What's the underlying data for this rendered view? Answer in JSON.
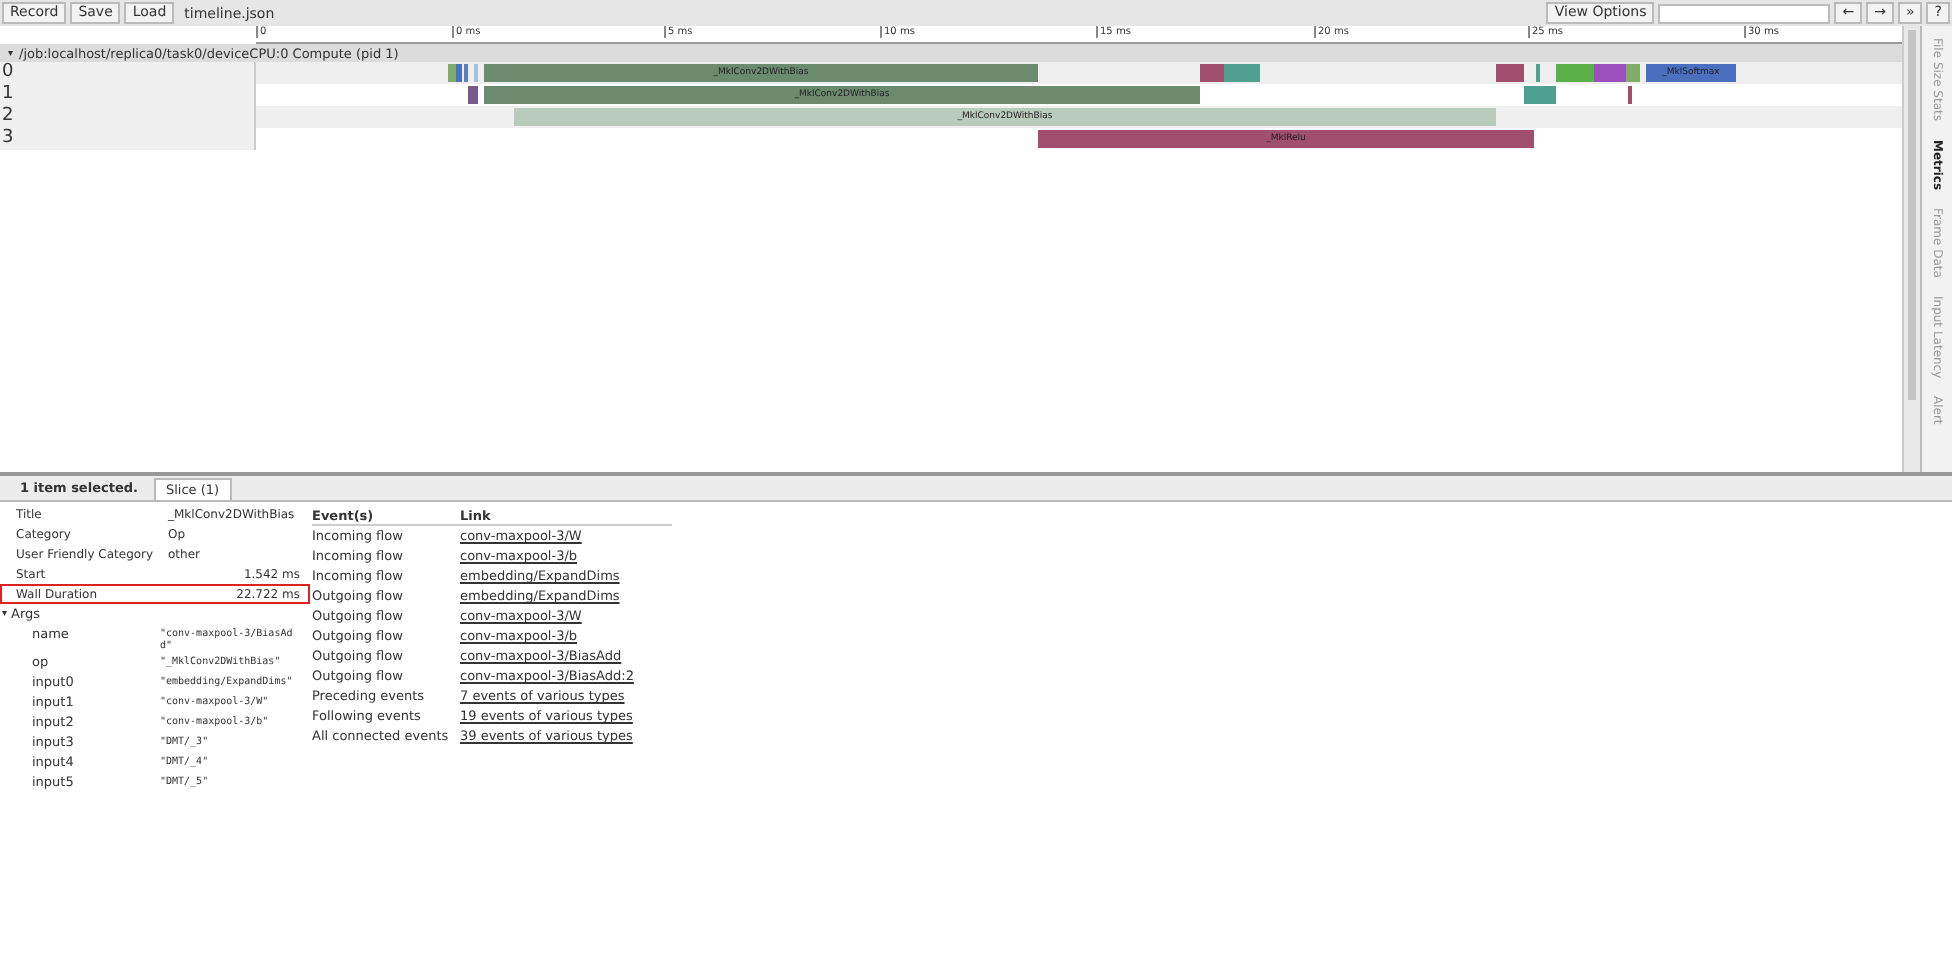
{
  "toolbar": {
    "buttons": [
      "Record",
      "Save",
      "Load"
    ],
    "filename": "timeline.json",
    "view_options": "View Options",
    "nav_buttons": [
      "←",
      "→",
      "»",
      "?"
    ]
  },
  "ruler": {
    "ticks": [
      "0",
      "0 ms",
      "5 ms",
      "10 ms",
      "15 ms",
      "20 ms",
      "25 ms",
      "30 ms"
    ]
  },
  "process": {
    "caret": "▾",
    "title": "/job:localhost/replica0/task0/deviceCPU:0 Compute (pid 1)",
    "expanded": true,
    "threads": [
      {
        "name": "0",
        "slices": [
          {
            "color": "#7fae6a"
          },
          {
            "color": "#4a6fbf"
          },
          {
            "color": "#5a7fc0"
          },
          {
            "color": "#9fc4e0"
          },
          {
            "label": "_MklConv2DWithBias",
            "color": "#6b8a6e"
          },
          {
            "color": "#a04f6c"
          },
          {
            "color": "#4fa08f"
          },
          {
            "color": "#a04f6c"
          },
          {
            "color": "#4fa08f"
          },
          {
            "color": "#5cb04a"
          },
          {
            "color": "#9d4fbf"
          },
          {
            "color": "#7fae6a"
          },
          {
            "label": "_MklSoftmax",
            "color": "#4a6fbf"
          }
        ]
      },
      {
        "name": "1",
        "slices": [
          {
            "color": "#7a5a8c"
          },
          {
            "label": "_MklConv2DWithBias",
            "color": "#6b8a6e"
          },
          {
            "color": "#4fa08f"
          },
          {
            "color": "#a04f6c"
          }
        ]
      },
      {
        "name": "2",
        "slices": [
          {
            "label": "_MklConv2DWithBias",
            "color": "#b8cbbd"
          }
        ]
      },
      {
        "name": "3",
        "slices": [
          {
            "label": "_MklRelu",
            "color": "#a04f6c"
          }
        ]
      }
    ]
  },
  "side_tabs": [
    {
      "label": "File Size Stats",
      "selected": false
    },
    {
      "label": "Metrics",
      "selected": true
    },
    {
      "label": "Frame Data",
      "selected": false
    },
    {
      "label": "Input Latency",
      "selected": false
    },
    {
      "label": "Alert",
      "selected": false
    }
  ],
  "details": {
    "summary": "1 item selected.",
    "tabs": [
      {
        "label": "Slice (1)",
        "selected": true
      }
    ],
    "fields": [
      {
        "name": "Title",
        "value": "_MklConv2DWithBias",
        "kind": "text",
        "highlighted": false
      },
      {
        "name": "Category",
        "value": "Op",
        "kind": "text",
        "highlighted": false
      },
      {
        "name": "User Friendly Category",
        "value": "other",
        "kind": "text",
        "highlighted": false
      },
      {
        "name": "Start",
        "value": "1.542 ms",
        "kind": "number",
        "highlighted": false
      },
      {
        "name": "Wall Duration",
        "value": "22.722 ms",
        "kind": "number",
        "highlighted": true
      }
    ],
    "args": {
      "caret": "▾",
      "label": "Args",
      "expanded": true,
      "items": [
        {
          "name": "name",
          "value": "\"conv-maxpool-3/BiasAdd\""
        },
        {
          "name": "op",
          "value": "\"_MklConv2DWithBias\""
        },
        {
          "name": "input0",
          "value": "\"embedding/ExpandDims\""
        },
        {
          "name": "input1",
          "value": "\"conv-maxpool-3/W\""
        },
        {
          "name": "input2",
          "value": "\"conv-maxpool-3/b\""
        },
        {
          "name": "input3",
          "value": "\"DMT/_3\""
        },
        {
          "name": "input4",
          "value": "\"DMT/_4\""
        },
        {
          "name": "input5",
          "value": "\"DMT/_5\""
        }
      ]
    },
    "events": {
      "columns": [
        "Event(s)",
        "Link"
      ],
      "rows": [
        {
          "event": "Incoming flow",
          "link": "conv-maxpool-3/W"
        },
        {
          "event": "Incoming flow",
          "link": "conv-maxpool-3/b"
        },
        {
          "event": "Incoming flow",
          "link": "embedding/ExpandDims"
        },
        {
          "event": "Outgoing flow",
          "link": "embedding/ExpandDims"
        },
        {
          "event": "Outgoing flow",
          "link": "conv-maxpool-3/W"
        },
        {
          "event": "Outgoing flow",
          "link": "conv-maxpool-3/b"
        },
        {
          "event": "Outgoing flow",
          "link": "conv-maxpool-3/BiasAdd"
        },
        {
          "event": "Outgoing flow",
          "link": "conv-maxpool-3/BiasAdd:2"
        },
        {
          "event": "Preceding events",
          "link": "7 events of various types"
        },
        {
          "event": "Following events",
          "link": "19 events of various types"
        },
        {
          "event": "All connected events",
          "link": "39 events of various types"
        }
      ]
    }
  }
}
